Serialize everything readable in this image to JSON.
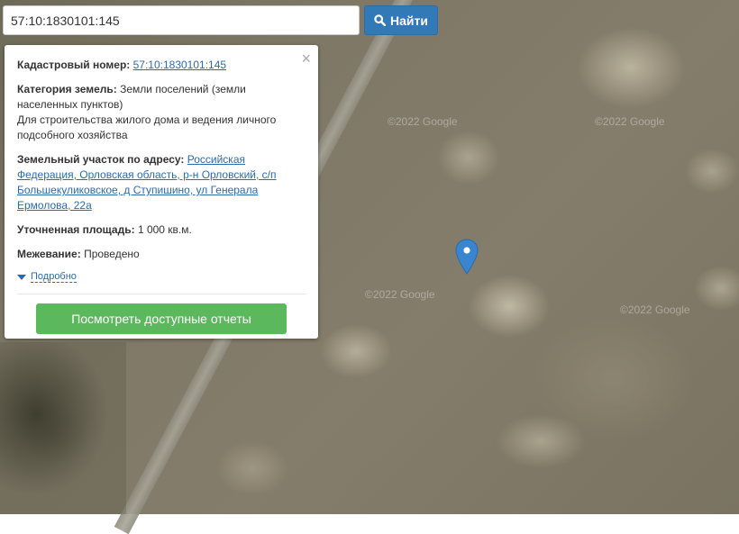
{
  "search": {
    "value": "57:10:1830101:145",
    "button_label": "Найти",
    "icon": "search-icon"
  },
  "popup": {
    "close_symbol": "×",
    "cadastral_label": "Кадастровый номер:",
    "cadastral_value": "57:10:1830101:145",
    "category_label": "Категория земель:",
    "category_value": "Земли поселений (земли населенных пунктов)",
    "usage": "Для строительства жилого дома и ведения личного подсобного хозяйства",
    "address_label": "Земельный участок по адресу:",
    "address_value": "Российская Федерация, Орловская область, р-н Орловский, с/п Большекуликовское, д Ступишино, ул Генерала Ермолова, 22а",
    "area_label": "Уточненная площадь:",
    "area_value": "1 000 кв.м.",
    "survey_label": "Межевание:",
    "survey_value": "Проведено",
    "details_label": "Подробно",
    "reports_button": "Посмотреть доступные отчеты"
  },
  "map": {
    "watermark": "©2022 Google",
    "marker_icon": "map-marker-icon",
    "colors": {
      "search_button": "#3279b7",
      "reports_button": "#5cb85c",
      "link": "#2a6bb0",
      "marker": "#3a85d0"
    }
  }
}
